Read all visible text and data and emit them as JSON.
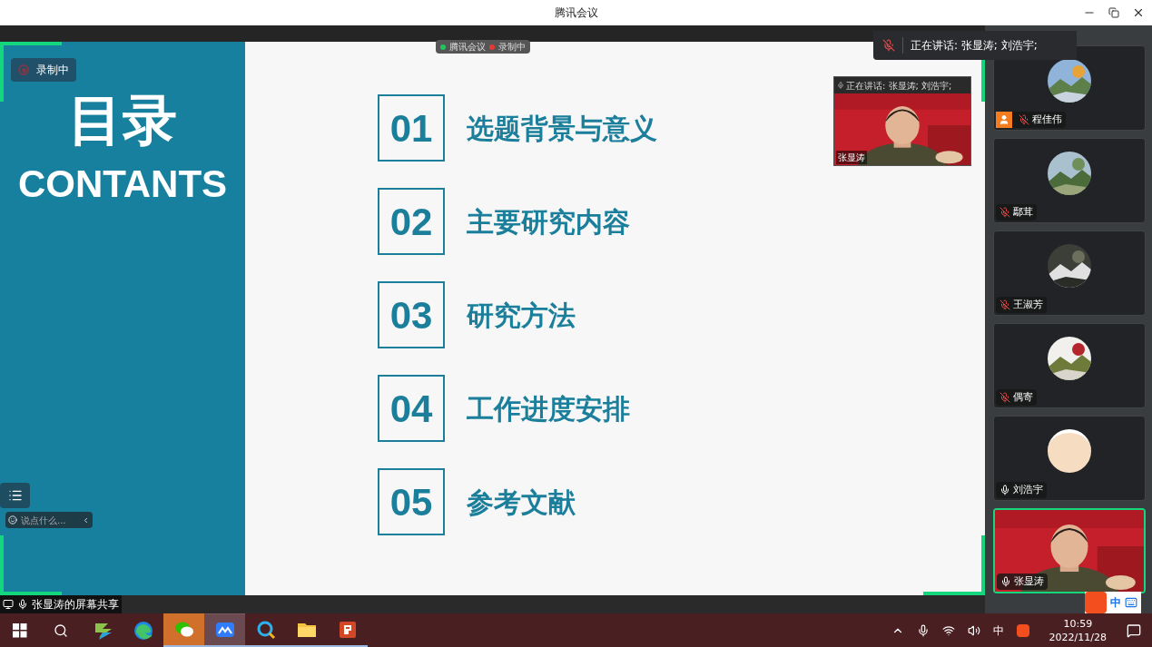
{
  "window": {
    "title": "腾讯会议"
  },
  "recording": {
    "label": "录制中"
  },
  "meeting_chip": {
    "app": "腾讯会议",
    "recording": "录制中"
  },
  "speaking_banner": {
    "text": "正在讲话: 张显涛; 刘浩宇;"
  },
  "slide": {
    "heading": "目录",
    "subheading": "CONTANTS",
    "items": [
      {
        "number": "01",
        "title": "选题背景与意义"
      },
      {
        "number": "02",
        "title": "主要研究内容"
      },
      {
        "number": "03",
        "title": "研究方法"
      },
      {
        "number": "04",
        "title": "工作进度安排"
      },
      {
        "number": "05",
        "title": "参考文献"
      }
    ]
  },
  "mini_video": {
    "speaking": "正在讲话: 张显涛; 刘浩宇;",
    "name": "张显涛"
  },
  "chat_bar": {
    "placeholder": "说点什么..."
  },
  "participants": [
    {
      "name": "程佳伟",
      "kind": "avatar",
      "muted": true,
      "host": true,
      "speaking": false
    },
    {
      "name": "鄢茸",
      "kind": "avatar",
      "muted": true,
      "host": false,
      "speaking": false
    },
    {
      "name": "王淑芳",
      "kind": "avatar",
      "muted": true,
      "host": false,
      "speaking": false
    },
    {
      "name": "偶寄",
      "kind": "avatar",
      "muted": true,
      "host": false,
      "speaking": false
    },
    {
      "name": "刘浩宇",
      "kind": "avatar",
      "muted": false,
      "host": false,
      "speaking": false
    },
    {
      "name": "张显涛",
      "kind": "video",
      "muted": false,
      "host": false,
      "speaking": true
    }
  ],
  "share_label": "张显涛的屏幕共享",
  "ime": {
    "mode": "中"
  },
  "taskbar": {
    "apps": [
      {
        "kind": "stack",
        "selected": false,
        "running": false,
        "flashing": false
      },
      {
        "kind": "edge",
        "selected": false,
        "running": false,
        "flashing": false
      },
      {
        "kind": "chat",
        "selected": false,
        "running": true,
        "flashing": true
      },
      {
        "kind": "meeting",
        "selected": true,
        "running": true,
        "flashing": false
      },
      {
        "kind": "search",
        "selected": false,
        "running": true,
        "flashing": false
      },
      {
        "kind": "folder",
        "selected": false,
        "running": true,
        "flashing": false
      },
      {
        "kind": "slides",
        "selected": false,
        "running": true,
        "flashing": false
      }
    ],
    "tray_language": "中",
    "time": "10:59",
    "date": "2022/11/28"
  }
}
